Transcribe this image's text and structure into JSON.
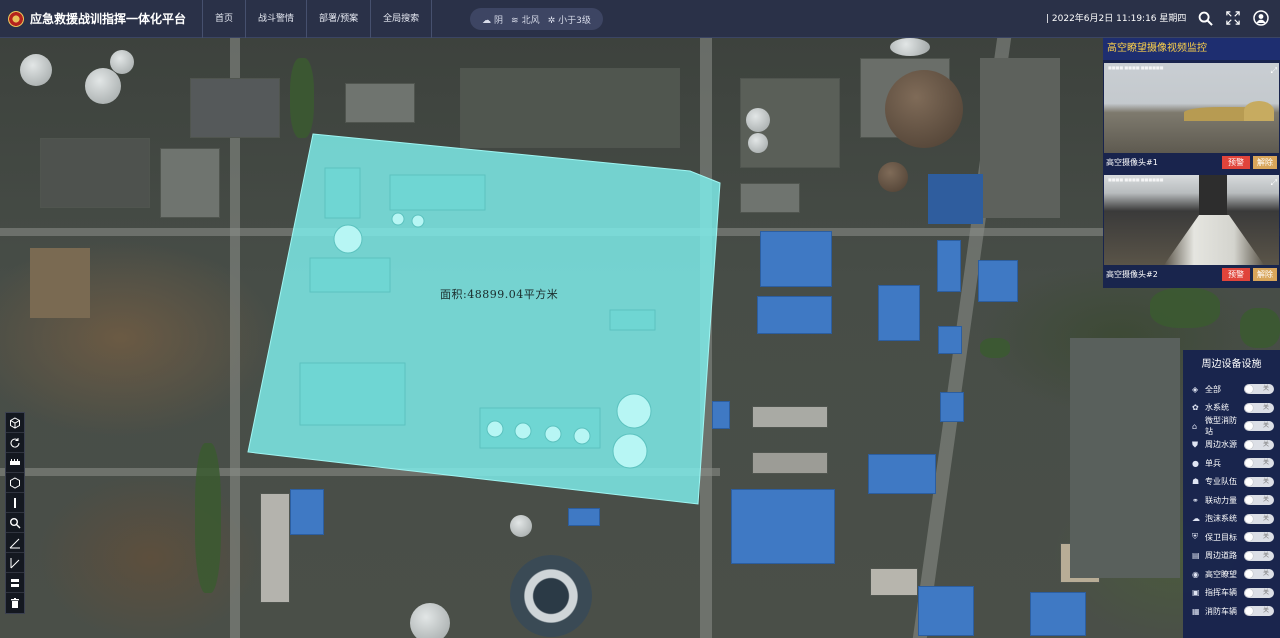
{
  "header": {
    "title": "应急救援战训指挥一体化平台",
    "nav": [
      "首页",
      "战斗警情",
      "部署/预案",
      "全局搜索"
    ],
    "weather": {
      "condition": "阴",
      "wind_dir": "北风",
      "wind_level": "小于3级"
    },
    "datetime": "| 2022年6月2日 11:19:16 星期四"
  },
  "map": {
    "area_label": "面积:48899.04平方米",
    "highlight_color": "#7ff0ee"
  },
  "video_panel": {
    "title": "高空瞭望摄像视频监控",
    "cameras": [
      {
        "name": "高空摄像头#1",
        "alarm": "预警",
        "dismiss": "解除"
      },
      {
        "name": "高空摄像头#2",
        "alarm": "预警",
        "dismiss": "解除"
      }
    ]
  },
  "facility_panel": {
    "title": "周边设备设施",
    "items": [
      {
        "label": "全部",
        "icon": "layers-icon",
        "state": "关"
      },
      {
        "label": "水系统",
        "icon": "water-icon",
        "state": "关"
      },
      {
        "label": "微型消防站",
        "icon": "station-icon",
        "state": "关"
      },
      {
        "label": "周边水源",
        "icon": "hydrant-icon",
        "state": "关"
      },
      {
        "label": "单兵",
        "icon": "person-icon",
        "state": "关"
      },
      {
        "label": "专业队伍",
        "icon": "team-icon",
        "state": "关"
      },
      {
        "label": "联动力量",
        "icon": "link-icon",
        "state": "关"
      },
      {
        "label": "泡沫系统",
        "icon": "foam-icon",
        "state": "关"
      },
      {
        "label": "保卫目标",
        "icon": "shield-icon",
        "state": "关"
      },
      {
        "label": "周边道路",
        "icon": "road-icon",
        "state": "关"
      },
      {
        "label": "高空瞭望",
        "icon": "camera-icon",
        "state": "关"
      },
      {
        "label": "指挥车辆",
        "icon": "command-car-icon",
        "state": "关"
      },
      {
        "label": "消防车辆",
        "icon": "fire-truck-icon",
        "state": "关"
      }
    ]
  },
  "left_tools": [
    "cube-icon",
    "rotate-icon",
    "ruler-icon",
    "box-icon",
    "column-icon",
    "search-icon",
    "angle-icon",
    "slope-icon",
    "layer-icon",
    "trash-icon"
  ],
  "colors": {
    "topbar": "#2a3148",
    "panel": "#16224e",
    "accent_title": "#ffd24a",
    "alarm": "#e0443b",
    "dismiss": "#d8a55a"
  }
}
